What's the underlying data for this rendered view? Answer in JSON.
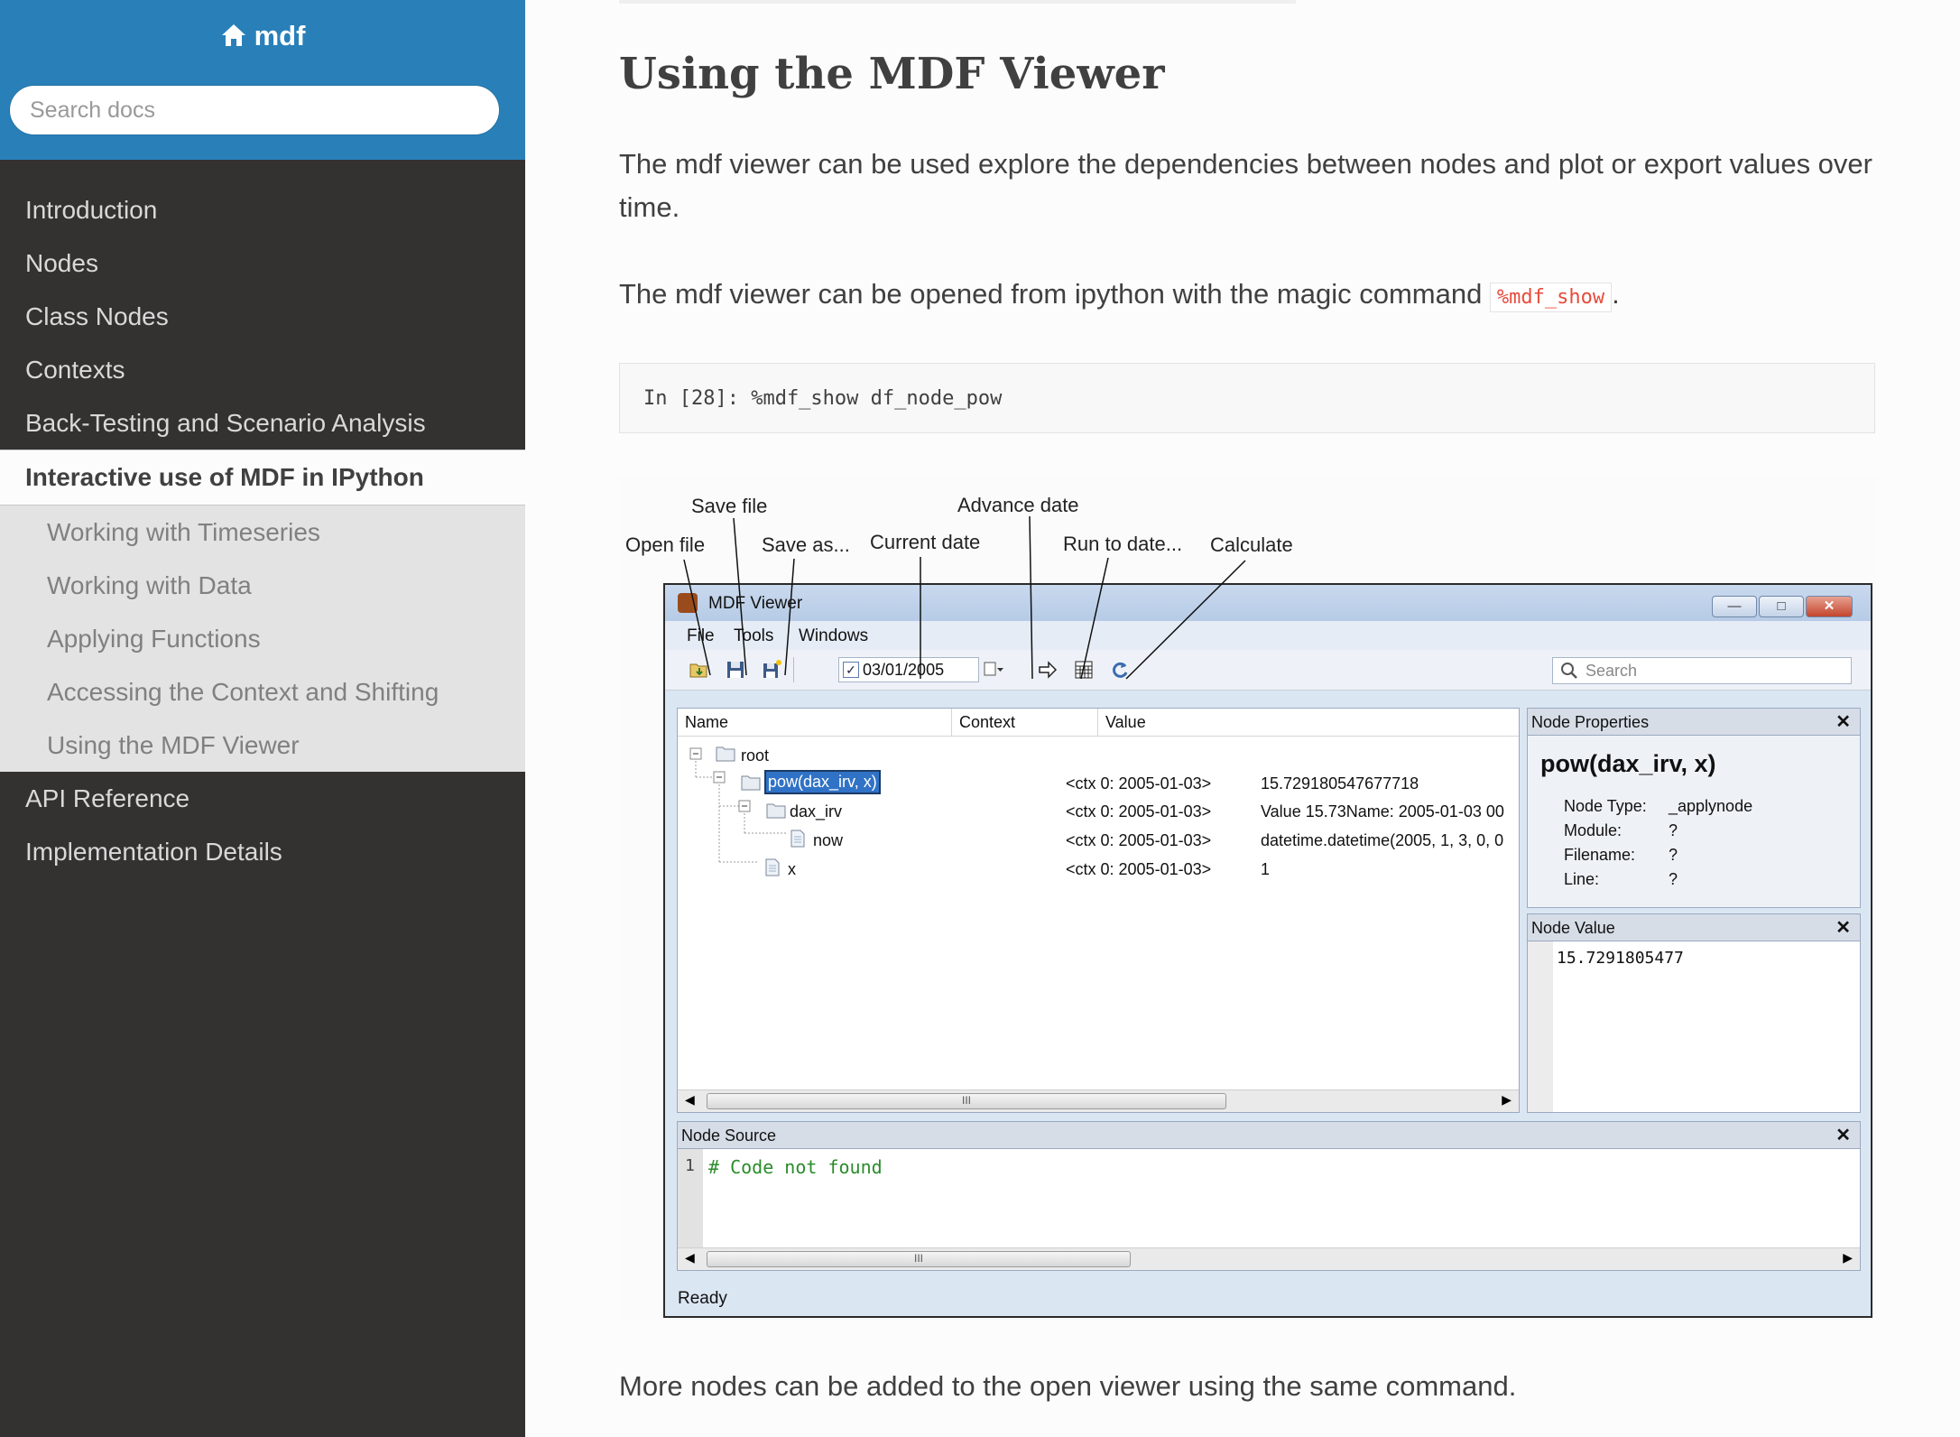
{
  "sidebar": {
    "brand": "mdf",
    "search_placeholder": "Search docs",
    "items": [
      {
        "label": "Introduction"
      },
      {
        "label": "Nodes"
      },
      {
        "label": "Class Nodes"
      },
      {
        "label": "Contexts"
      },
      {
        "label": "Back-Testing and Scenario Analysis"
      },
      {
        "label": "Interactive use of MDF in IPython"
      },
      {
        "label": "Working with Timeseries"
      },
      {
        "label": "Working with Data"
      },
      {
        "label": "Applying Functions"
      },
      {
        "label": "Accessing the Context and Shifting"
      },
      {
        "label": "Using the MDF Viewer"
      },
      {
        "label": "API Reference"
      },
      {
        "label": "Implementation Details"
      }
    ]
  },
  "main": {
    "title": "Using the MDF Viewer",
    "para1": "The mdf viewer can be used explore the dependencies between nodes and plot or export values over time.",
    "para2_before": "The mdf viewer can be opened from ipython with the magic command ",
    "para2_code": "%mdf_show",
    "para2_after": ".",
    "code": "In [28]: %mdf_show df_node_pow",
    "para3": "More nodes can be added to the open viewer using the same command."
  },
  "figure": {
    "callouts": {
      "save_file": "Save file",
      "advance_date": "Advance date",
      "open_file": "Open file",
      "save_as": "Save as...",
      "current_date": "Current date",
      "run_to_date": "Run to date...",
      "calculate": "Calculate"
    },
    "window": {
      "title": "MDF Viewer",
      "menus": [
        "File",
        "Tools",
        "Windows"
      ],
      "date": "03/01/2005",
      "search_placeholder": "Search",
      "columns": [
        "Name",
        "Context",
        "Value"
      ],
      "rows": [
        {
          "name": "root",
          "context": "",
          "value": ""
        },
        {
          "name": "pow(dax_irv, x)",
          "context": "<ctx 0: 2005-01-03>",
          "value": "15.729180547677718"
        },
        {
          "name": "dax_irv",
          "context": "<ctx 0: 2005-01-03>",
          "value": "Value    15.73Name: 2005-01-03 00"
        },
        {
          "name": "now",
          "context": "<ctx 0: 2005-01-03>",
          "value": "datetime.datetime(2005, 1, 3, 0, 0"
        },
        {
          "name": "x",
          "context": "<ctx 0: 2005-01-03>",
          "value": "1"
        }
      ],
      "node_properties": {
        "header": "Node Properties",
        "name": "pow(dax_irv, x)",
        "fields": [
          {
            "label": "Node Type:",
            "value": "_applynode"
          },
          {
            "label": "Module:",
            "value": "?"
          },
          {
            "label": "Filename:",
            "value": "?"
          },
          {
            "label": "Line:",
            "value": "?"
          }
        ]
      },
      "node_value": {
        "header": "Node Value",
        "value": "15.7291805477"
      },
      "node_source": {
        "header": "Node Source",
        "line_no": "1",
        "code": "# Code not found"
      },
      "status": "Ready"
    }
  },
  "colors": {
    "sidebar_top": "#2980b9",
    "sidebar_bg": "#343131",
    "code_red": "#e74c3c",
    "comment_green": "#2a8c2a"
  }
}
